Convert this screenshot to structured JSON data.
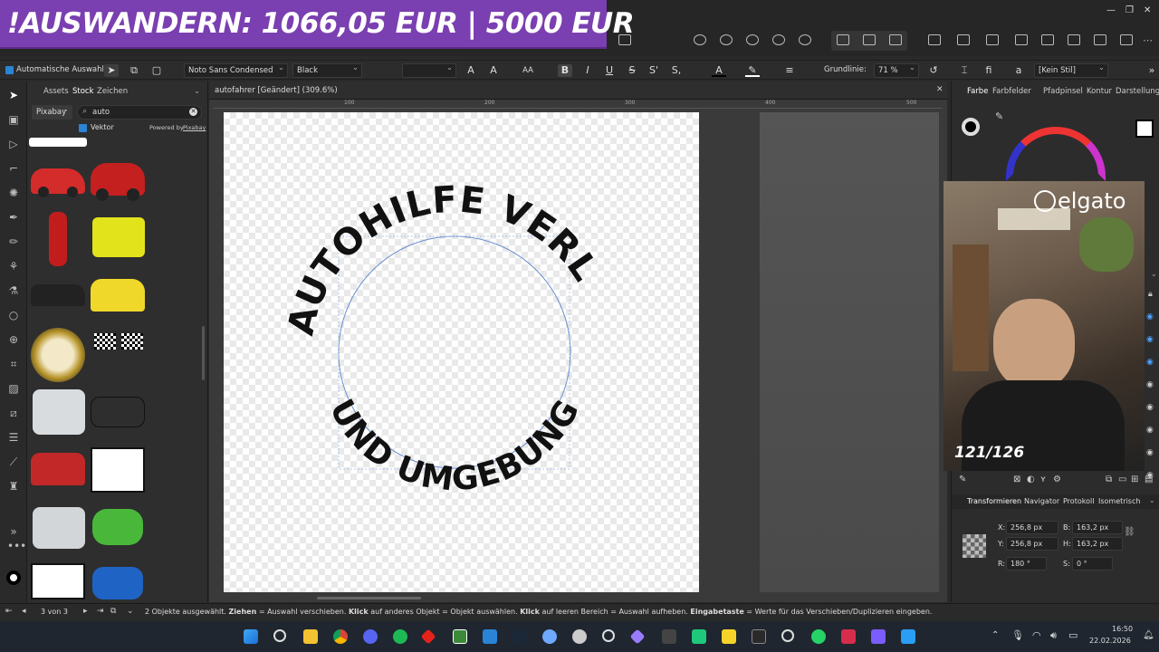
{
  "banner": {
    "text": "!AUSWANDERN: 1066,05 EUR | 5000 EUR"
  },
  "context_toolbar": {
    "auto_select_label": "Automatische Auswahl:",
    "font_family": "Noto Sans Condensed",
    "font_weight": "Black",
    "baseline_label": "Grundlinie:",
    "baseline_value": "71 %",
    "style_value": "[Kein Stil]",
    "bold_label": "B",
    "italic_label": "I",
    "underline_label": "U",
    "strike_label": "S",
    "super_label": "S'",
    "sub_label": "S,",
    "aa_label": "AA"
  },
  "left_panel": {
    "tabs": [
      "Assets",
      "Stock",
      "Zeichen"
    ],
    "source": "Pixabay",
    "search_value": "auto",
    "vector_label": "Vektor",
    "powered_by": "Powered by",
    "powered_brand": "Pixabay"
  },
  "document": {
    "title": "autofahrer [Geändert] (309.6%)",
    "ruler_ticks": [
      "100",
      "200",
      "300",
      "400",
      "500"
    ],
    "text_top": "AUTOHILFE VERL",
    "text_bottom": "UND UMGEBUNG"
  },
  "right_panel": {
    "tabs": [
      "Farbe",
      "Farbfelder",
      "Pfadpinsel",
      "Kontur",
      "Darstellung"
    ],
    "bottom_tabs": [
      "Transformieren",
      "Navigator",
      "Protokoll",
      "Isometrisch"
    ],
    "transform": {
      "x_label": "X:",
      "x_value": "256,8 px",
      "y_label": "Y:",
      "y_value": "256,8 px",
      "w_label": "B:",
      "w_value": "163,2 px",
      "h_label": "H:",
      "h_value": "163,2 px",
      "r_label": "R:",
      "r_value": "180 °",
      "s_label": "S:",
      "s_value": "0 °"
    },
    "webcam_brand": "elgato",
    "webcam_counter": "121/126"
  },
  "status_bar": {
    "page_indicator": "3 von 3",
    "message_parts": [
      "2 Objekte ausgewählt. ",
      "Ziehen",
      " = Auswahl verschieben. ",
      "Klick",
      " auf anderes Objekt = Objekt auswählen. ",
      "Klick",
      " auf leeren Bereich = Auswahl aufheben. ",
      "Eingabetaste",
      " = Werte für das Verschieben/Duplizieren eingeben."
    ]
  },
  "taskbar": {
    "time": "16:50",
    "date": "22.02.2026"
  },
  "colors": {
    "accent": "#2a84d6",
    "banner": "#7a3fb0",
    "taskbar": "#1f2630"
  }
}
